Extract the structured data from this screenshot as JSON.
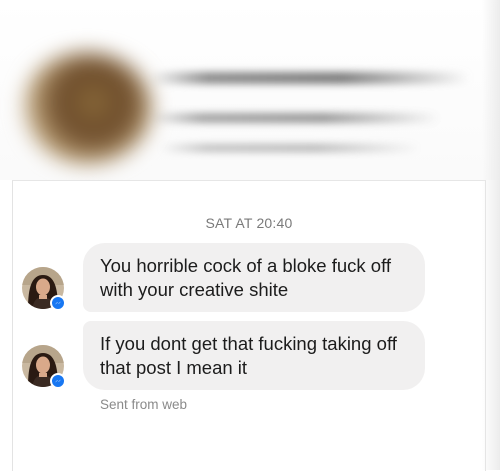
{
  "conversation": {
    "timestamp": "SAT AT 20:40",
    "messages": [
      {
        "text": "You horrible cock of a bloke fuck off with your creative shite"
      },
      {
        "text": "If you dont get that fucking taking off that post I mean it"
      }
    ],
    "footer_note": "Sent from web"
  },
  "colors": {
    "bubble": "#f1f0f0",
    "messenger_badge": "#1877f2",
    "timestamp_text": "#7a7a7a"
  },
  "icons": {
    "badge": "messenger-icon"
  }
}
